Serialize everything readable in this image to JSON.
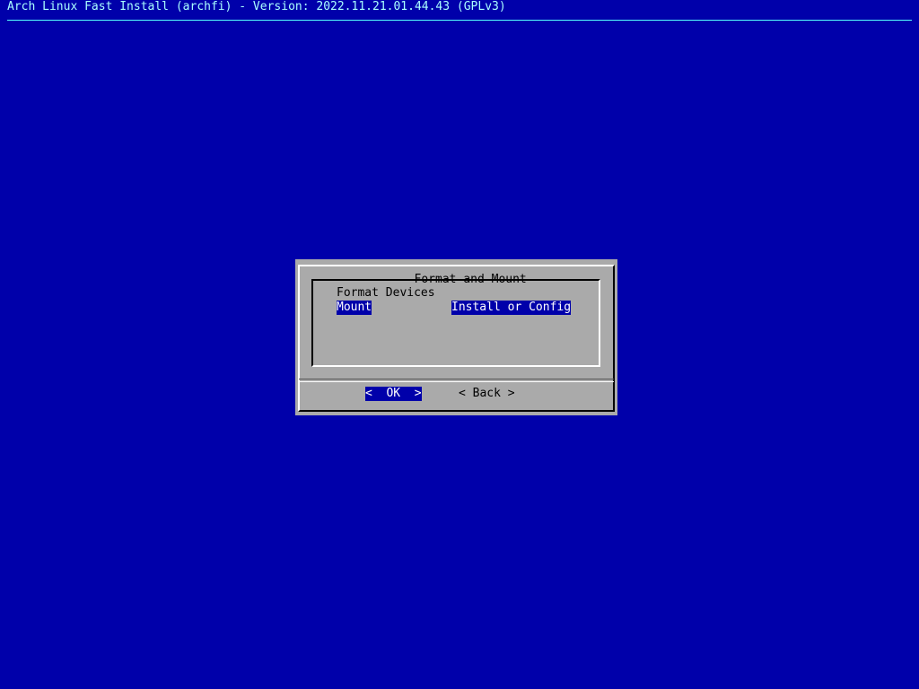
{
  "backtitle": "Arch Linux Fast Install (archfi) - Version: 2022.11.21.01.44.43 (GPLv3)",
  "dialog": {
    "title": "Format and Mount",
    "menu": [
      {
        "tag": "Format Devices",
        "desc": ""
      },
      {
        "tag": "Mount",
        "desc": "Install or Config",
        "selected": true
      }
    ],
    "buttons": {
      "ok": "<  OK  >",
      "back": "< Back >"
    }
  },
  "colors": {
    "background": "#0000aa",
    "dialog": "#aaaaaa",
    "highlight": "#0000aa",
    "highlight_text": "#ffffff",
    "backtitle_text": "#aaffff"
  }
}
